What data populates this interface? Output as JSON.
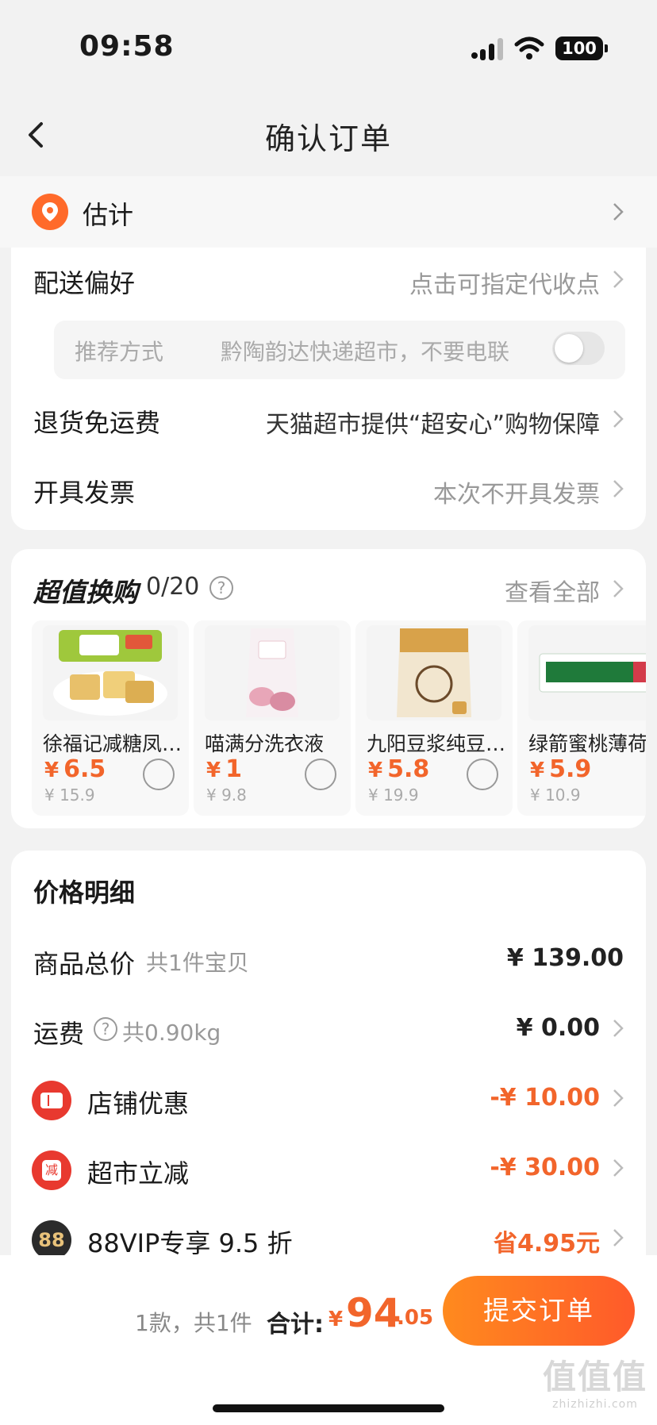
{
  "status_bar": {
    "time": "09:58",
    "battery": "100"
  },
  "header": {
    "title": "确认订单"
  },
  "address": {
    "label": "估计"
  },
  "delivery": {
    "pref_label": "配送偏好",
    "pref_value": "点击可指定代收点",
    "recommend_label": "推荐方式",
    "recommend_value": "黔陶韵达快递超市，不要电联",
    "return_label": "退货免运费",
    "return_value": "天猫超市提供“超安心”购物保障",
    "invoice_label": "开具发票",
    "invoice_value": "本次不开具发票"
  },
  "exchange": {
    "title": "超值换购",
    "count": "0/20",
    "help": "?",
    "view_all": "查看全部",
    "currency": "¥",
    "products": [
      {
        "name": "徐福记减糖凤梨酥",
        "price": "6.5",
        "original": "¥ 15.9"
      },
      {
        "name": "喵满分洗衣液",
        "price": "1",
        "original": "¥ 9.8"
      },
      {
        "name": "九阳豆浆纯豆浆粉",
        "price": "5.8",
        "original": "¥ 19.9"
      },
      {
        "name": "绿箭蜜桃薄荷糖",
        "price": "5.9",
        "original": "¥ 10.9"
      }
    ]
  },
  "price_detail": {
    "title": "价格明细",
    "goods_label": "商品总价",
    "goods_sub": "共1件宝贝",
    "goods_value": "¥ 139.00",
    "shipping_label": "运费",
    "shipping_help": "?",
    "shipping_sub": "共0.90kg",
    "shipping_value": "¥ 0.00",
    "store_label": "店铺优惠",
    "store_value": "-¥ 10.00",
    "market_label": "超市立减",
    "market_badge": "减",
    "market_value": "-¥ 30.00",
    "vip_badge": "88",
    "vip_label": "88VIP专享 9.5 折",
    "vip_value": "省4.95元"
  },
  "bottom": {
    "count": "1款，共1件",
    "total_label": "合计:",
    "currency": "¥",
    "total_int": "94",
    "total_dec": ".05",
    "submit": "提交订单"
  },
  "watermark": {
    "text": "值值值",
    "sub": "zhizhizhi.com"
  },
  "colors": {
    "accent": "#f2652b",
    "background": "#f2f2f2",
    "card": "#ffffff",
    "badge_red": "#e8392f"
  }
}
